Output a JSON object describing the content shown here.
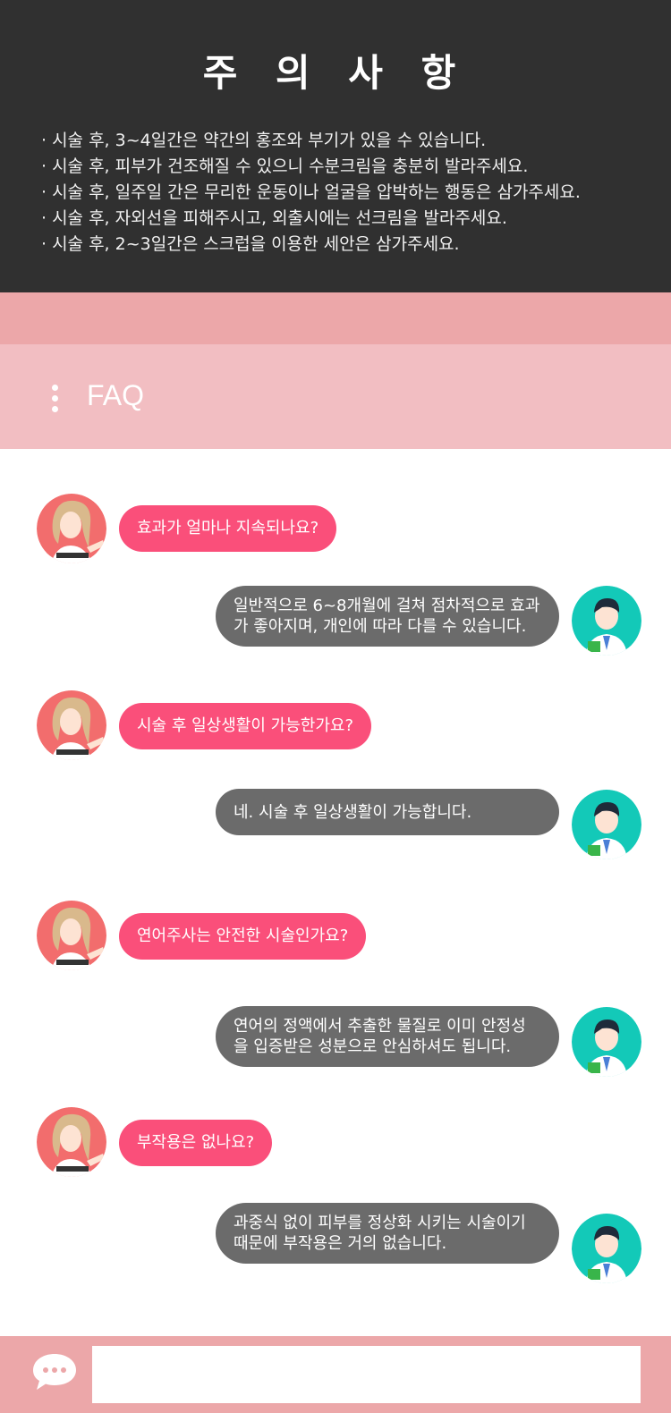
{
  "notice": {
    "title": "주 의 사 항",
    "items": [
      "· 시술 후, 3~4일간은 약간의 홍조와 부기가 있을 수 있습니다.",
      "· 시술 후, 피부가 건조해질 수 있으니 수분크림을 충분히 발라주세요.",
      "· 시술 후, 일주일 간은 무리한 운동이나 얼굴을 압박하는 행동은 삼가주세요.",
      "· 시술 후, 자외선을 피해주시고, 외출시에는 선크림을 발라주세요.",
      "· 시술 후, 2~3일간은 스크럽을 이용한 세안은 삼가주세요."
    ]
  },
  "faq": {
    "title": "FAQ",
    "menu_icon": "kebab-menu-icon",
    "items": [
      {
        "question": "효과가 얼마나 지속되나요?",
        "answer_lines": [
          "일반적으로 6~8개월에 걸쳐 점차적으로 효과",
          "가 좋아지며, 개인에 따라 다를 수 있습니다."
        ]
      },
      {
        "question": "시술 후 일상생활이 가능한가요?",
        "answer_lines": [
          "네. 시술 후 일상생활이 가능합니다."
        ]
      },
      {
        "question": "연어주사는 안전한 시술인가요?",
        "answer_lines": [
          "연어의 정액에서 추출한 물질로 이미 안정성",
          "을 입증받은 성분으로 안심하셔도 됩니다."
        ]
      },
      {
        "question": "부작용은 없나요?",
        "answer_lines": [
          "과중식 없이 피부를 정상화 시키는 시술이기",
          "때문에 부작용은 거의 없습니다."
        ]
      }
    ]
  },
  "input_bar": {
    "icon": "chat-bubble-icon",
    "placeholder": ""
  },
  "colors": {
    "notice_bg": "#303030",
    "band": "#eca7a9",
    "faq_header": "#f2bec2",
    "question_bubble": "#fa4f7a",
    "answer_bubble": "#6b6b6b",
    "customer_avatar_bg": "#f26d6d",
    "doctor_avatar_bg": "#13c9b8"
  }
}
